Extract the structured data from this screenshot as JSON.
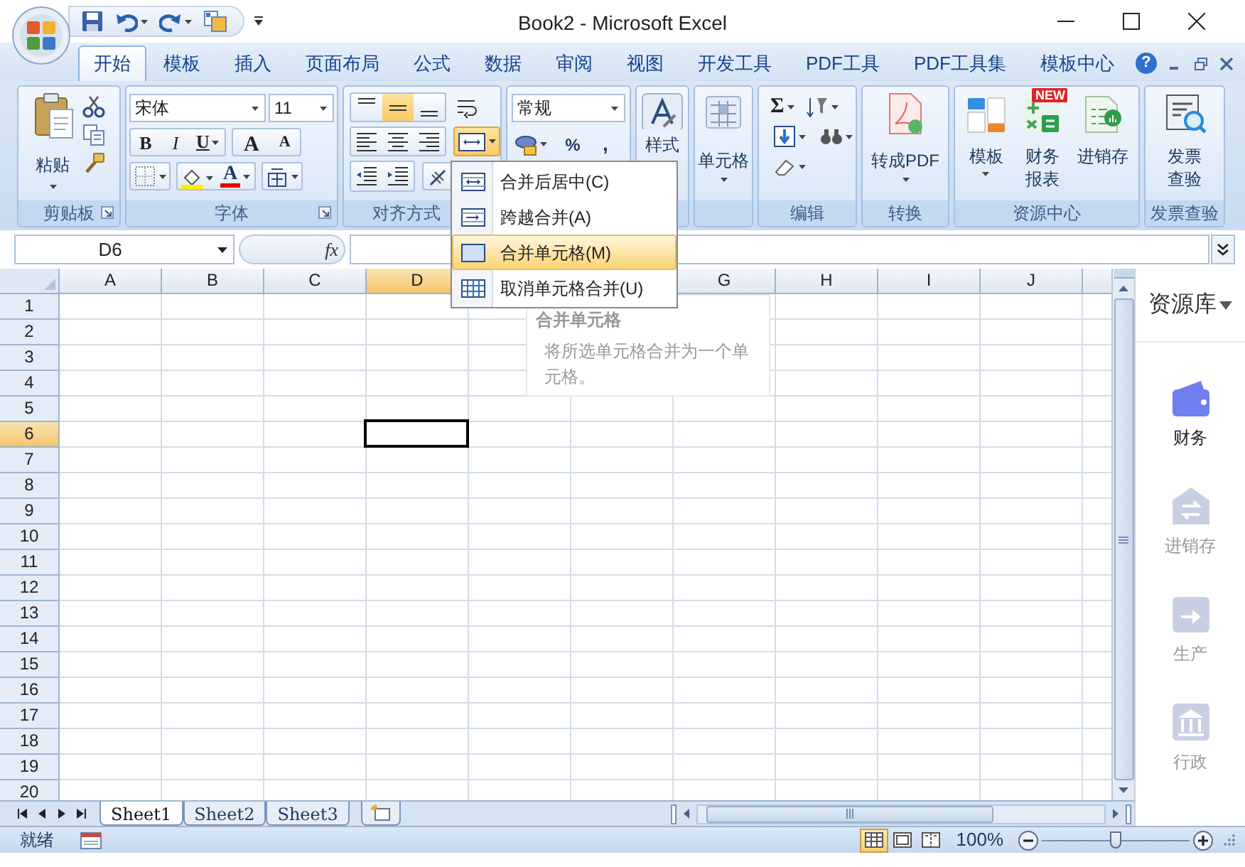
{
  "window": {
    "title": "Book2 - Microsoft Excel"
  },
  "ribbon_tabs": [
    {
      "label": "开始",
      "selected": true
    },
    {
      "label": "模板",
      "selected": false
    },
    {
      "label": "插入",
      "selected": false
    },
    {
      "label": "页面布局",
      "selected": false
    },
    {
      "label": "公式",
      "selected": false
    },
    {
      "label": "数据",
      "selected": false
    },
    {
      "label": "审阅",
      "selected": false
    },
    {
      "label": "视图",
      "selected": false
    },
    {
      "label": "开发工具",
      "selected": false
    },
    {
      "label": "PDF工具",
      "selected": false
    },
    {
      "label": "PDF工具集",
      "selected": false
    },
    {
      "label": "模板中心",
      "selected": false
    }
  ],
  "help": "?",
  "clipboard": {
    "paste": "粘贴",
    "label": "剪贴板"
  },
  "font": {
    "font_name": "宋体",
    "font_size": "11",
    "bold": "B",
    "italic": "I",
    "underline": "U",
    "grow_font": "A",
    "shrink_font": "A",
    "font_color": "A",
    "label": "字体"
  },
  "alignment": {
    "vertical_align": [
      {
        "selected": false
      },
      {
        "selected": true
      },
      {
        "selected": false
      }
    ],
    "label": "对齐方式"
  },
  "number": {
    "format": "常规",
    "percent": "%",
    "comma": ","
  },
  "styles": {
    "button": "样式"
  },
  "cells": {
    "button": "单元格"
  },
  "editing": {
    "sum": "Σ",
    "label": "编辑"
  },
  "convert": {
    "button": "转成PDF",
    "label": "转换"
  },
  "resource_center": {
    "buttons": [
      {
        "kind": "template",
        "label": "模板"
      },
      {
        "kind": "finance",
        "label": "财务报表",
        "badge": "NEW"
      },
      {
        "kind": "inventory",
        "label": "进销存"
      }
    ],
    "label": "资源中心"
  },
  "invoice": {
    "button": "发票查验",
    "label": "发票查验"
  },
  "merge_menu": {
    "open": true,
    "items": [
      {
        "kind": "merge_center",
        "label": "合并后居中(C)",
        "selected": false
      },
      {
        "kind": "merge_across",
        "label": "跨越合并(A)",
        "selected": false
      },
      {
        "kind": "merge_cells",
        "label": "合并单元格(M)",
        "selected": true
      },
      {
        "kind": "unmerge",
        "label": "取消单元格合并(U)",
        "selected": false
      }
    ]
  },
  "tooltip": {
    "title": "合并单元格",
    "text": "将所选单元格合并为一个单元格。"
  },
  "formula_bar": {
    "name_box": "D6",
    "function_label": "fx"
  },
  "columns": [
    {
      "label": "A",
      "selected": false
    },
    {
      "label": "B",
      "selected": false
    },
    {
      "label": "C",
      "selected": false
    },
    {
      "label": "D",
      "selected": true
    },
    {
      "label": "G",
      "selected": false
    },
    {
      "label": "H",
      "selected": false
    },
    {
      "label": "I",
      "selected": false
    },
    {
      "label": "J",
      "selected": false
    }
  ],
  "rows": [
    {
      "label": "1",
      "selected": false
    },
    {
      "label": "2",
      "selected": false
    },
    {
      "label": "3",
      "selected": false
    },
    {
      "label": "4",
      "selected": false
    },
    {
      "label": "5",
      "selected": false
    },
    {
      "label": "6",
      "selected": true
    },
    {
      "label": "7",
      "selected": false
    },
    {
      "label": "8",
      "selected": false
    },
    {
      "label": "9",
      "selected": false
    },
    {
      "label": "10",
      "selected": false
    },
    {
      "label": "11",
      "selected": false
    },
    {
      "label": "12",
      "selected": false
    },
    {
      "label": "13",
      "selected": false
    },
    {
      "label": "14",
      "selected": false
    },
    {
      "label": "15",
      "selected": false
    },
    {
      "label": "16",
      "selected": false
    },
    {
      "label": "17",
      "selected": false
    },
    {
      "label": "18",
      "selected": false
    },
    {
      "label": "19",
      "selected": false
    },
    {
      "label": "20",
      "selected": false
    }
  ],
  "sheet_tabs": [
    {
      "label": "Sheet1",
      "selected": true
    },
    {
      "label": "Sheet2",
      "selected": false
    },
    {
      "label": "Sheet3",
      "selected": false
    }
  ],
  "status_bar": {
    "status": "就绪",
    "views": [
      {
        "kind": "normal",
        "selected": true
      },
      {
        "kind": "page_layout",
        "selected": false
      },
      {
        "kind": "page_break",
        "selected": false
      }
    ],
    "zoom": "100%",
    "zoom_slider": {
      "level": 0.5
    }
  },
  "resource_panel": {
    "title": "资源库",
    "items": [
      {
        "kind": "finance",
        "label": "财务",
        "selected": true
      },
      {
        "kind": "inventory",
        "label": "进销存",
        "selected": false
      },
      {
        "kind": "production",
        "label": "生产",
        "selected": false
      },
      {
        "kind": "administration",
        "label": "行政",
        "selected": false
      }
    ]
  }
}
